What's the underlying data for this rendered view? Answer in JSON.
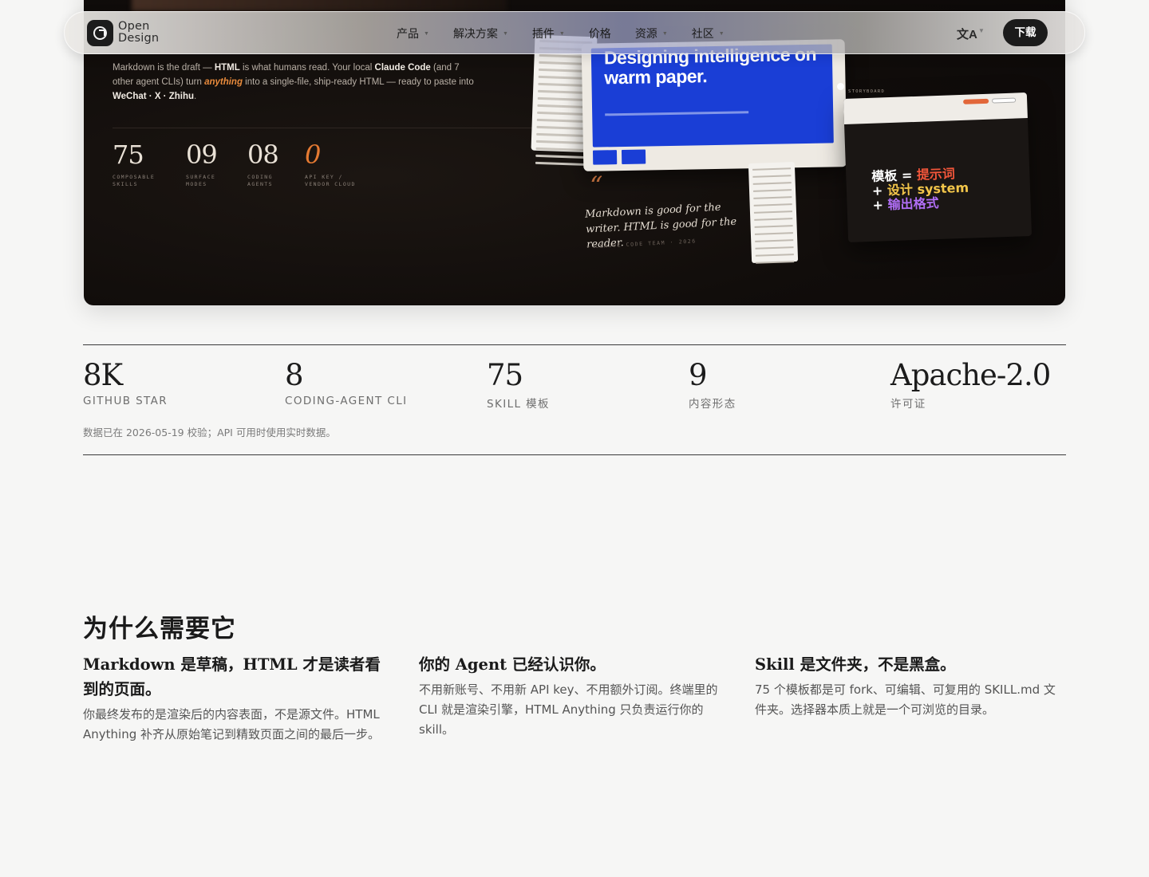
{
  "nav": {
    "logo_line1": "Open",
    "logo_line2": "Design",
    "logo_icon": "open-design-logo-icon",
    "items": [
      {
        "label": "产品",
        "has_dropdown": true
      },
      {
        "label": "解决方案",
        "has_dropdown": true
      },
      {
        "label": "插件",
        "has_dropdown": true
      },
      {
        "label": "价格",
        "has_dropdown": false
      },
      {
        "label": "资源",
        "has_dropdown": true
      },
      {
        "label": "社区",
        "has_dropdown": true
      }
    ],
    "language_icon": "translate-icon",
    "download_label": "下载"
  },
  "hero": {
    "intro": {
      "p1": "Markdown is the draft — ",
      "b1": "HTML",
      "p2": " is what humans read. Your local ",
      "b2": "Claude Code",
      "p3": " (and 7 other agent CLIs) turn ",
      "hl": "anything",
      "p4": " into a single-file, ship-ready HTML — ready to paste into ",
      "b3": "WeChat · X · Zhihu",
      "p5": "."
    },
    "stats": [
      {
        "value": "75",
        "label": "COMPOSABLE SKILLS"
      },
      {
        "value": "09",
        "label": "SURFACE MODES"
      },
      {
        "value": "08",
        "label": "CODING AGENTS"
      },
      {
        "value": "0",
        "label": "API KEY / VENDOR CLOUD"
      }
    ],
    "mock_title": "Designing intelligence on warm paper.",
    "quote_mark": "“",
    "quote": "Markdown is good for the writer. HTML is good for the reader.",
    "quote_by": "— CLAUDE CODE TEAM · 2026",
    "storyboard_label": "STORYBOARD",
    "template_eq": {
      "w1": "模板",
      "eq": " = ",
      "o1": "提示词",
      "plus1": "+ ",
      "y1": "设计 system",
      "plus2": "+ ",
      "p1": "输出格式"
    },
    "colors": {
      "accent_orange": "#e57a32",
      "blue": "#1a3ed6"
    }
  },
  "stats": [
    {
      "value": "8K",
      "label": "GITHUB STAR"
    },
    {
      "value": "8",
      "label": "CODING-AGENT CLI"
    },
    {
      "value": "75",
      "label": "SKILL 模板"
    },
    {
      "value": "9",
      "label": "内容形态"
    },
    {
      "value": "Apache-2.0",
      "label": "许可证"
    }
  ],
  "verify_note": "数据已在 2026-05-19 校验；API 可用时使用实时数据。",
  "why": {
    "title": "为什么需要它",
    "columns": [
      {
        "title": "Markdown 是草稿，HTML 才是读者看到的页面。",
        "body": "你最终发布的是渲染后的内容表面，不是源文件。HTML Anything 补齐从原始笔记到精致页面之间的最后一步。"
      },
      {
        "title": "你的 Agent 已经认识你。",
        "body": "不用新账号、不用新 API key、不用额外订阅。终端里的 CLI 就是渲染引擎，HTML Anything 只负责运行你的 skill。"
      },
      {
        "title": "Skill 是文件夹，不是黑盒。",
        "body": "75 个模板都是可 fork、可编辑、可复用的 SKILL.md 文件夹。选择器本质上就是一个可浏览的目录。"
      }
    ]
  }
}
